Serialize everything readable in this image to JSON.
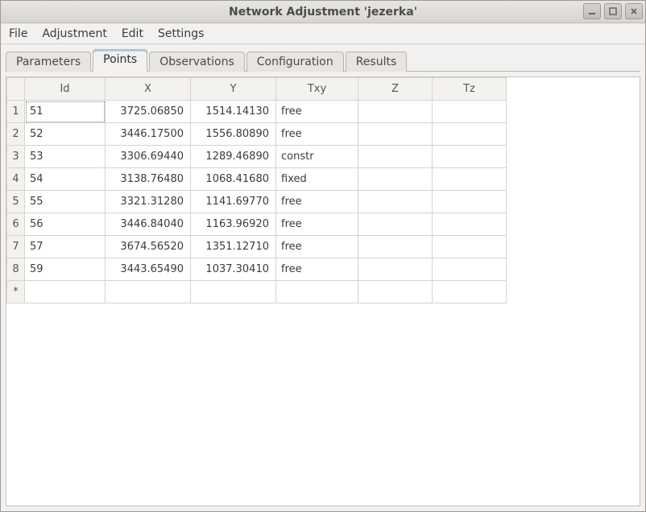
{
  "window": {
    "title": "Network Adjustment 'jezerka'"
  },
  "menu": {
    "items": [
      "File",
      "Adjustment",
      "Edit",
      "Settings"
    ]
  },
  "tabs": {
    "items": [
      "Parameters",
      "Points",
      "Observations",
      "Configuration",
      "Results"
    ],
    "active_index": 1
  },
  "table": {
    "columns": [
      "Id",
      "X",
      "Y",
      "Txy",
      "Z",
      "Tz"
    ],
    "row_headers": [
      "1",
      "2",
      "3",
      "4",
      "5",
      "6",
      "7",
      "8",
      "*"
    ],
    "rows": [
      {
        "id": "51",
        "x": "3725.06850",
        "y": "1514.14130",
        "txy": "free",
        "z": "",
        "tz": ""
      },
      {
        "id": "52",
        "x": "3446.17500",
        "y": "1556.80890",
        "txy": "free",
        "z": "",
        "tz": ""
      },
      {
        "id": "53",
        "x": "3306.69440",
        "y": "1289.46890",
        "txy": "constr",
        "z": "",
        "tz": ""
      },
      {
        "id": "54",
        "x": "3138.76480",
        "y": "1068.41680",
        "txy": "fixed",
        "z": "",
        "tz": ""
      },
      {
        "id": "55",
        "x": "3321.31280",
        "y": "1141.69770",
        "txy": "free",
        "z": "",
        "tz": ""
      },
      {
        "id": "56",
        "x": "3446.84040",
        "y": "1163.96920",
        "txy": "free",
        "z": "",
        "tz": ""
      },
      {
        "id": "57",
        "x": "3674.56520",
        "y": "1351.12710",
        "txy": "free",
        "z": "",
        "tz": ""
      },
      {
        "id": "59",
        "x": "3443.65490",
        "y": "1037.30410",
        "txy": "free",
        "z": "",
        "tz": ""
      },
      {
        "id": "",
        "x": "",
        "y": "",
        "txy": "",
        "z": "",
        "tz": ""
      }
    ],
    "selected_cell": {
      "row": 0,
      "col": "id"
    }
  }
}
